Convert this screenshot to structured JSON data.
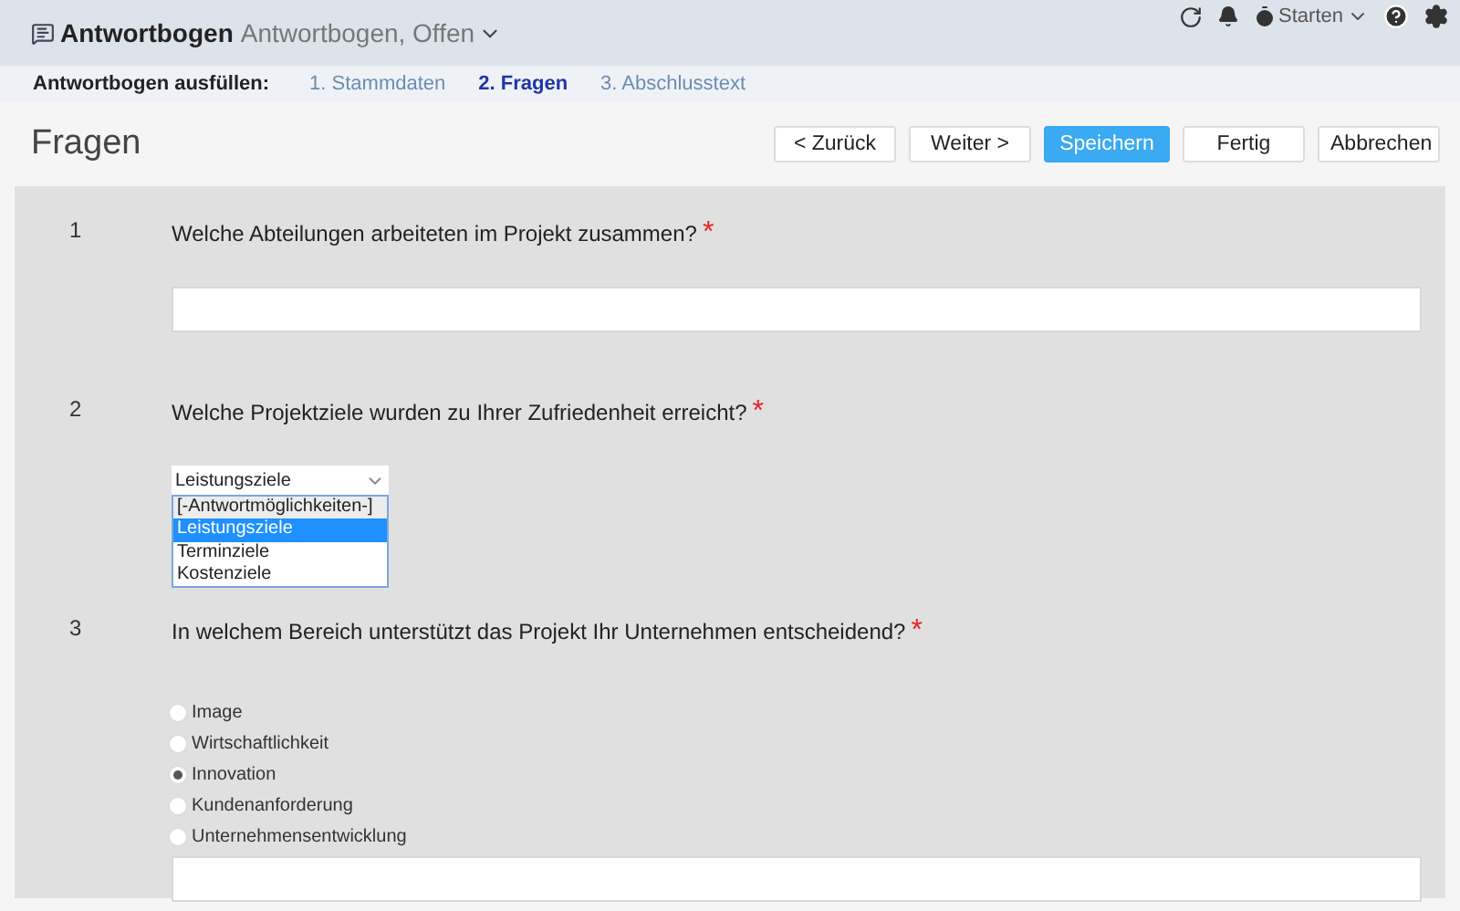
{
  "header": {
    "title": "Antwortbogen",
    "subtitle": "Antwortbogen, Offen",
    "start_label": "Starten"
  },
  "steps": {
    "label": "Antwortbogen ausfüllen:",
    "items": [
      {
        "label": "1. Stammdaten",
        "selected": false
      },
      {
        "label": "2. Fragen",
        "selected": true
      },
      {
        "label": "3. Abschlusstext",
        "selected": false
      }
    ]
  },
  "page_title": "Fragen",
  "buttons": [
    {
      "label": "< Zurück",
      "primary": false
    },
    {
      "label": "Weiter >",
      "primary": false
    },
    {
      "label": "Speichern",
      "primary": true
    },
    {
      "label": "Fertig",
      "primary": false
    },
    {
      "label": "Abbrechen",
      "primary": false
    }
  ],
  "questions": [
    {
      "number": "1",
      "text": "Welche Abteilungen arbeiteten im Projekt zusammen?",
      "required_mark": "*",
      "kind": "text"
    },
    {
      "number": "2",
      "text": "Welche Projektziele wurden zu Ihrer Zufriedenheit erreicht?",
      "required_mark": "*",
      "kind": "select",
      "value": "Leistungsziele",
      "options": [
        {
          "label": "[-Antwortmöglichkeiten-]",
          "selected": false
        },
        {
          "label": "Leistungsziele",
          "selected": true
        },
        {
          "label": "Terminziele",
          "selected": false
        },
        {
          "label": "Kostenziele",
          "selected": false
        }
      ]
    },
    {
      "number": "3",
      "text": "In welchem Bereich unterstützt das Projekt Ihr Unternehmen entscheidend?",
      "required_mark": "*",
      "kind": "radio",
      "options": [
        {
          "label": "Image",
          "selected": false
        },
        {
          "label": "Wirtschaftlichkeit",
          "selected": false
        },
        {
          "label": "Innovation",
          "selected": true
        },
        {
          "label": "Kundenanforderung",
          "selected": false
        },
        {
          "label": "Unternehmensentwicklung",
          "selected": false
        }
      ]
    }
  ]
}
